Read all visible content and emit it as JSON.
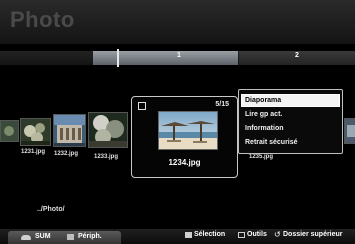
{
  "window": {
    "title": "Photo"
  },
  "pages": {
    "current": "1",
    "next": "2"
  },
  "thumbnails": [
    {
      "name": "1231.jpg"
    },
    {
      "name": "1232.jpg"
    },
    {
      "name": "1233.jpg"
    },
    {
      "name": "1234.jpg"
    },
    {
      "name": "1235.jpg"
    }
  ],
  "focus": {
    "counter": "5/15",
    "name": "1234.jpg"
  },
  "context_menu": {
    "items": [
      "Diaporama",
      "Lire gp act.",
      "Information",
      "Retrait sécurisé"
    ],
    "selected_index": 0
  },
  "path": "../Photo/",
  "device_bar": {
    "sum_label": "SUM",
    "periph_label": "Périph."
  },
  "hints": {
    "select_label": "Sélection",
    "tools_label": "Outils",
    "return_label": "Dossier supérieur"
  },
  "colors": {
    "menu_highlight": "#f4f4f4",
    "title_text": "#4a4a4a",
    "page_active": "#80868c"
  }
}
